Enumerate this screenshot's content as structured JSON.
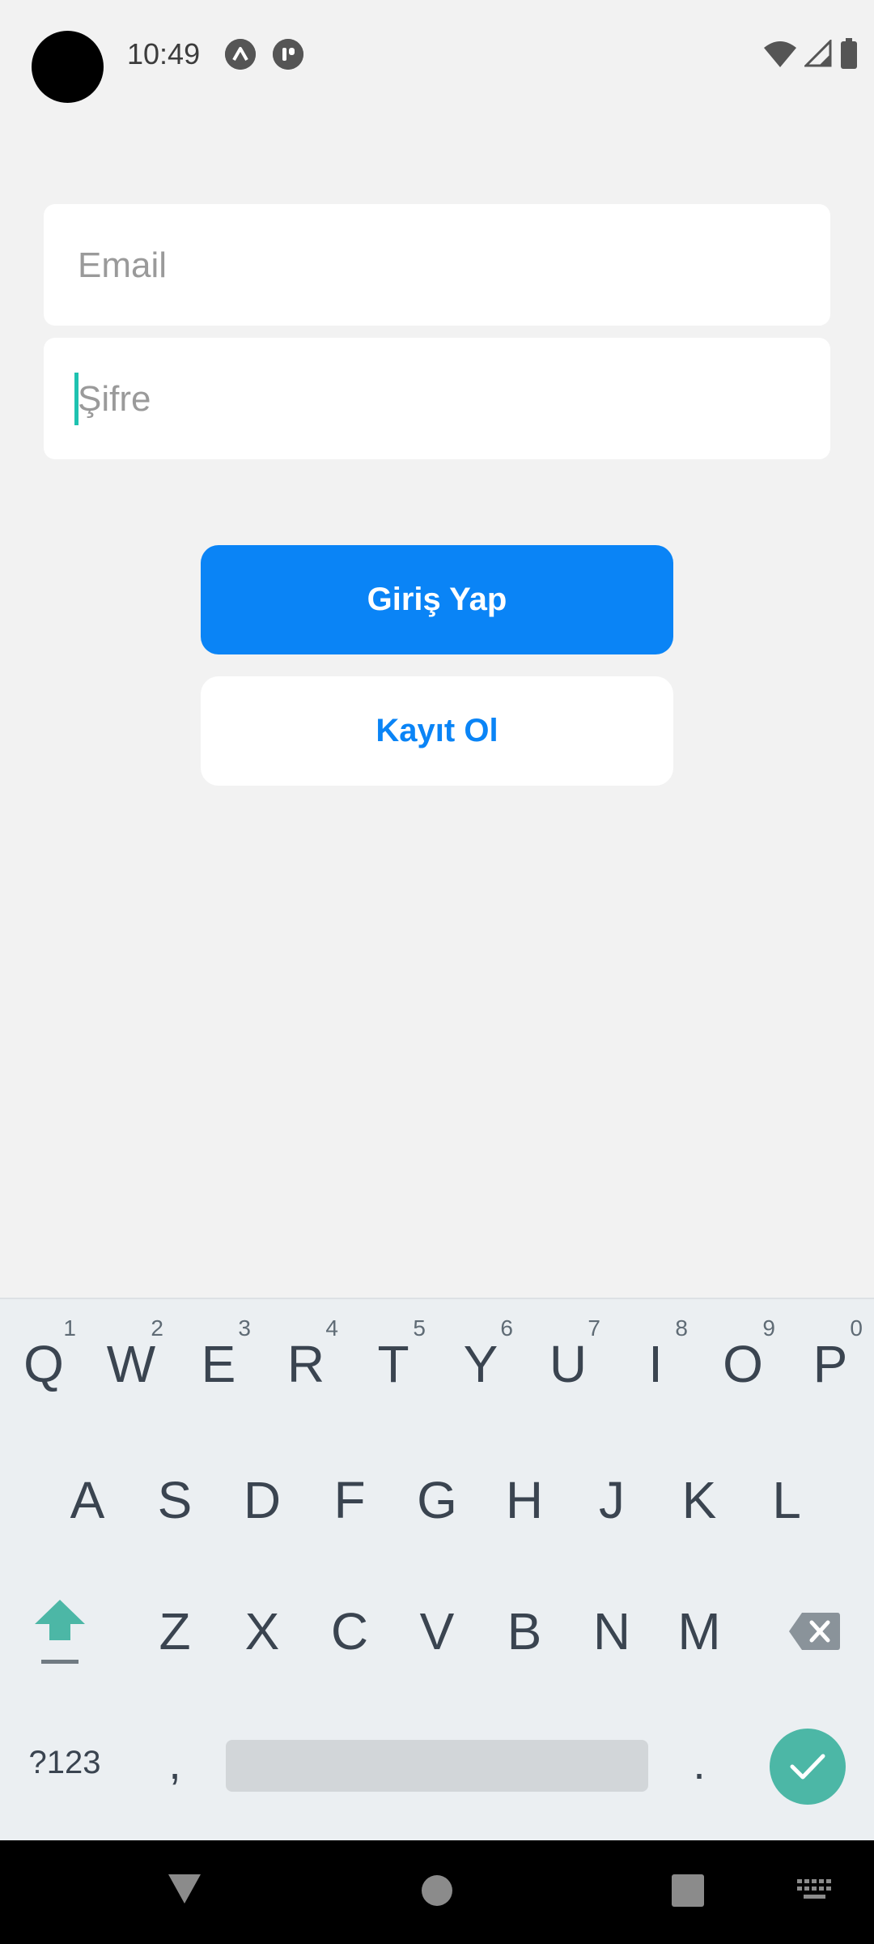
{
  "status_bar": {
    "time": "10:49"
  },
  "form": {
    "email_placeholder": "Email",
    "password_placeholder": "Şifre",
    "login_label": "Giriş Yap",
    "register_label": "Kayıt Ol"
  },
  "keyboard": {
    "row1": [
      {
        "label": "Q",
        "hint": "1"
      },
      {
        "label": "W",
        "hint": "2"
      },
      {
        "label": "E",
        "hint": "3"
      },
      {
        "label": "R",
        "hint": "4"
      },
      {
        "label": "T",
        "hint": "5"
      },
      {
        "label": "Y",
        "hint": "6"
      },
      {
        "label": "U",
        "hint": "7"
      },
      {
        "label": "I",
        "hint": "8"
      },
      {
        "label": "O",
        "hint": "9"
      },
      {
        "label": "P",
        "hint": "0"
      }
    ],
    "row2": [
      "A",
      "S",
      "D",
      "F",
      "G",
      "H",
      "J",
      "K",
      "L"
    ],
    "row3": [
      "Z",
      "X",
      "C",
      "V",
      "B",
      "N",
      "M"
    ],
    "symbols_label": "?123",
    "comma_label": ",",
    "period_label": "."
  },
  "colors": {
    "primary": "#0a84f6",
    "accent": "#4cb7a6"
  }
}
